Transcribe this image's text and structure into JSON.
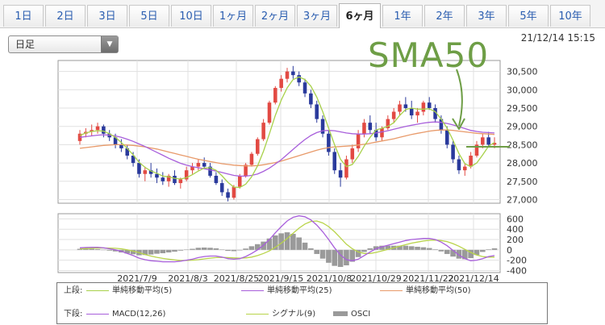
{
  "tabs": [
    {
      "label": "1日",
      "active": false
    },
    {
      "label": "2日",
      "active": false
    },
    {
      "label": "3日",
      "active": false
    },
    {
      "label": "5日",
      "active": false
    },
    {
      "label": "10日",
      "active": false
    },
    {
      "label": "1ヶ月",
      "active": false
    },
    {
      "label": "2ヶ月",
      "active": false
    },
    {
      "label": "3ヶ月",
      "active": false
    },
    {
      "label": "6ヶ月",
      "active": true
    },
    {
      "label": "1年",
      "active": false
    },
    {
      "label": "2年",
      "active": false
    },
    {
      "label": "3年",
      "active": false
    },
    {
      "label": "5年",
      "active": false
    },
    {
      "label": "10年",
      "active": false
    }
  ],
  "interval_select": {
    "value": "日足"
  },
  "timestamp": "21/12/14 15:15",
  "annotation": "SMA50",
  "colors": {
    "sma5": "#a8d14a",
    "sma25": "#a85fdb",
    "sma50": "#e89a6a",
    "up": "#e24a43",
    "down": "#2a3a9c",
    "macd": "#a85fdb",
    "signal": "#b9d44a",
    "osci": "#9a9a9a",
    "callout": "#6e9e46"
  },
  "chart_data": {
    "type": "candlestick",
    "price_panel": {
      "yticks": [
        27000,
        27500,
        28000,
        28500,
        29000,
        29500,
        30000,
        30500
      ],
      "ylim": [
        26900,
        30800
      ],
      "x_tick_labels": [
        "2021/7/9",
        "2021/8/3",
        "2021/8/25",
        "2021/9/15",
        "2021/10/8",
        "2021/10/29",
        "2021/11/22",
        "2021/12/14"
      ],
      "candles": [
        [
          28600,
          28900,
          28500,
          28800
        ],
        [
          28800,
          28950,
          28700,
          28850
        ],
        [
          28850,
          29050,
          28750,
          28900
        ],
        [
          28900,
          29100,
          28800,
          29000
        ],
        [
          29000,
          29050,
          28700,
          28800
        ],
        [
          28800,
          28900,
          28600,
          28700
        ],
        [
          28700,
          28800,
          28400,
          28500
        ],
        [
          28500,
          28650,
          28300,
          28400
        ],
        [
          28400,
          28500,
          28100,
          28200
        ],
        [
          28200,
          28300,
          27900,
          28000
        ],
        [
          28000,
          28100,
          27600,
          27700
        ],
        [
          27700,
          27900,
          27500,
          27800
        ],
        [
          27800,
          28000,
          27600,
          27700
        ],
        [
          27700,
          27850,
          27450,
          27600
        ],
        [
          27600,
          27750,
          27400,
          27500
        ],
        [
          27500,
          27700,
          27350,
          27650
        ],
        [
          27650,
          27800,
          27400,
          27450
        ],
        [
          27450,
          27600,
          27300,
          27550
        ],
        [
          27550,
          27900,
          27500,
          27800
        ],
        [
          27800,
          28000,
          27700,
          27900
        ],
        [
          27900,
          28100,
          27800,
          28000
        ],
        [
          28000,
          28150,
          27850,
          27900
        ],
        [
          27900,
          28000,
          27600,
          27650
        ],
        [
          27650,
          27750,
          27400,
          27450
        ],
        [
          27450,
          27550,
          27100,
          27200
        ],
        [
          27200,
          27300,
          26950,
          27050
        ],
        [
          27050,
          27400,
          27000,
          27350
        ],
        [
          27350,
          27700,
          27300,
          27650
        ],
        [
          27650,
          28000,
          27600,
          27950
        ],
        [
          27950,
          28300,
          27900,
          28250
        ],
        [
          28250,
          28700,
          28200,
          28650
        ],
        [
          28650,
          29200,
          28600,
          29100
        ],
        [
          29100,
          29700,
          29050,
          29650
        ],
        [
          29650,
          30100,
          29600,
          30050
        ],
        [
          30050,
          30400,
          29950,
          30300
        ],
        [
          30300,
          30600,
          30200,
          30500
        ],
        [
          30500,
          30650,
          30300,
          30400
        ],
        [
          30400,
          30500,
          30100,
          30200
        ],
        [
          30200,
          30300,
          29800,
          29900
        ],
        [
          29900,
          30000,
          29500,
          29600
        ],
        [
          29600,
          29700,
          29100,
          29200
        ],
        [
          29200,
          29300,
          28700,
          28800
        ],
        [
          28800,
          28900,
          28200,
          28300
        ],
        [
          28300,
          28400,
          27700,
          27800
        ],
        [
          27800,
          28000,
          27350,
          27600
        ],
        [
          27600,
          28200,
          27550,
          28100
        ],
        [
          28100,
          28500,
          28000,
          28400
        ],
        [
          28400,
          28900,
          28300,
          28800
        ],
        [
          28800,
          29200,
          28700,
          29100
        ],
        [
          29100,
          29300,
          28800,
          28900
        ],
        [
          28900,
          29100,
          28600,
          28700
        ],
        [
          28700,
          29000,
          28600,
          28950
        ],
        [
          28950,
          29300,
          28900,
          29200
        ],
        [
          29200,
          29500,
          29100,
          29400
        ],
        [
          29400,
          29700,
          29300,
          29600
        ],
        [
          29600,
          29800,
          29400,
          29500
        ],
        [
          29500,
          29700,
          29200,
          29300
        ],
        [
          29300,
          29500,
          29100,
          29400
        ],
        [
          29400,
          29700,
          29300,
          29650
        ],
        [
          29650,
          29800,
          29450,
          29500
        ],
        [
          29500,
          29600,
          29100,
          29200
        ],
        [
          29200,
          29300,
          28800,
          28900
        ],
        [
          28900,
          29000,
          28400,
          28500
        ],
        [
          28500,
          28600,
          28000,
          28100
        ],
        [
          28100,
          28200,
          27700,
          27800
        ],
        [
          27800,
          28000,
          27650,
          27900
        ],
        [
          27900,
          28300,
          27850,
          28200
        ],
        [
          28200,
          28600,
          28150,
          28500
        ],
        [
          28500,
          28800,
          28400,
          28700
        ],
        [
          28700,
          28850,
          28450,
          28500
        ],
        [
          28500,
          28700,
          28400,
          28550
        ]
      ],
      "sma5": [
        28750,
        28820,
        28860,
        28880,
        28870,
        28800,
        28700,
        28560,
        28400,
        28220,
        28020,
        27880,
        27780,
        27720,
        27640,
        27620,
        27580,
        27560,
        27600,
        27680,
        27780,
        27860,
        27870,
        27800,
        27650,
        27470,
        27340,
        27330,
        27420,
        27620,
        27920,
        28320,
        28800,
        29300,
        29720,
        30050,
        30280,
        30350,
        30280,
        30100,
        29800,
        29400,
        28950,
        28500,
        28100,
        27900,
        27960,
        28180,
        28460,
        28700,
        28900,
        28950,
        29000,
        29100,
        29300,
        29460,
        29500,
        29470,
        29470,
        29480,
        29400,
        29200,
        28950,
        28620,
        28260,
        27980,
        27900,
        28000,
        28220,
        28460,
        28560
      ],
      "sma25": [
        28700,
        28720,
        28740,
        28760,
        28770,
        28760,
        28740,
        28700,
        28650,
        28590,
        28520,
        28450,
        28370,
        28290,
        28210,
        28130,
        28060,
        27990,
        27940,
        27900,
        27870,
        27840,
        27810,
        27780,
        27740,
        27700,
        27660,
        27640,
        27640,
        27660,
        27700,
        27770,
        27860,
        27970,
        28090,
        28230,
        28370,
        28510,
        28640,
        28750,
        28830,
        28880,
        28890,
        28880,
        28850,
        28820,
        28800,
        28790,
        28790,
        28800,
        28820,
        28850,
        28880,
        28920,
        28960,
        29000,
        29030,
        29060,
        29090,
        29110,
        29120,
        29110,
        29080,
        29040,
        28990,
        28940,
        28890,
        28860,
        28840,
        28830,
        28820
      ],
      "sma50": [
        28400,
        28420,
        28440,
        28460,
        28480,
        28490,
        28500,
        28500,
        28490,
        28480,
        28460,
        28440,
        28410,
        28380,
        28340,
        28300,
        28260,
        28220,
        28180,
        28140,
        28100,
        28070,
        28040,
        28010,
        27980,
        27960,
        27940,
        27930,
        27920,
        27920,
        27930,
        27950,
        27980,
        28010,
        28050,
        28100,
        28150,
        28200,
        28250,
        28300,
        28350,
        28390,
        28420,
        28440,
        28450,
        28460,
        28470,
        28490,
        28510,
        28540,
        28570,
        28600,
        28630,
        28660,
        28700,
        28740,
        28780,
        28810,
        28840,
        28870,
        28890,
        28900,
        28900,
        28890,
        28870,
        28850,
        28830,
        28810,
        28800,
        28790,
        28780
      ]
    },
    "macd_panel": {
      "yticks": [
        -400,
        -200,
        0,
        200,
        400,
        600
      ],
      "ylim": [
        -440,
        700
      ],
      "macd": [
        40,
        45,
        50,
        50,
        40,
        20,
        0,
        -30,
        -70,
        -110,
        -160,
        -190,
        -210,
        -220,
        -230,
        -230,
        -230,
        -220,
        -200,
        -180,
        -150,
        -130,
        -120,
        -120,
        -140,
        -170,
        -180,
        -170,
        -130,
        -70,
        0,
        90,
        200,
        330,
        450,
        560,
        630,
        660,
        640,
        580,
        480,
        350,
        200,
        40,
        -100,
        -190,
        -210,
        -180,
        -110,
        -40,
        20,
        60,
        90,
        120,
        150,
        180,
        200,
        210,
        220,
        220,
        200,
        150,
        80,
        -10,
        -100,
        -170,
        -210,
        -200,
        -170,
        -130,
        -110
      ],
      "signal": [
        20,
        25,
        30,
        35,
        37,
        35,
        30,
        20,
        0,
        -25,
        -55,
        -90,
        -120,
        -145,
        -165,
        -180,
        -195,
        -205,
        -205,
        -200,
        -190,
        -175,
        -160,
        -150,
        -145,
        -150,
        -155,
        -160,
        -155,
        -140,
        -110,
        -70,
        -20,
        50,
        130,
        220,
        320,
        420,
        500,
        550,
        560,
        520,
        450,
        350,
        230,
        110,
        20,
        -40,
        -70,
        -70,
        -50,
        -20,
        10,
        40,
        70,
        100,
        130,
        150,
        170,
        185,
        190,
        180,
        160,
        120,
        70,
        10,
        -50,
        -100,
        -130,
        -140,
        -140
      ],
      "osci": [
        20,
        20,
        20,
        15,
        3,
        -15,
        -30,
        -50,
        -70,
        -85,
        -105,
        -100,
        -90,
        -75,
        -65,
        -50,
        -35,
        -15,
        5,
        20,
        40,
        45,
        40,
        30,
        5,
        -20,
        -25,
        -10,
        25,
        70,
        110,
        160,
        220,
        280,
        320,
        340,
        310,
        240,
        140,
        30,
        -80,
        -170,
        -250,
        -310,
        -330,
        -300,
        -230,
        -140,
        -40,
        30,
        70,
        80,
        80,
        80,
        80,
        80,
        70,
        60,
        50,
        35,
        10,
        -30,
        -80,
        -130,
        -170,
        -180,
        -160,
        -100,
        -40,
        10,
        30
      ]
    }
  },
  "legend": {
    "upper_label": "上段:",
    "lower_label": "下段:",
    "sma5": "単純移動平均(5)",
    "sma25": "単純移動平均(25)",
    "sma50": "単純移動平均(50)",
    "macd": "MACD(12,26)",
    "signal": "シグナル(9)",
    "osci": "OSCI"
  }
}
